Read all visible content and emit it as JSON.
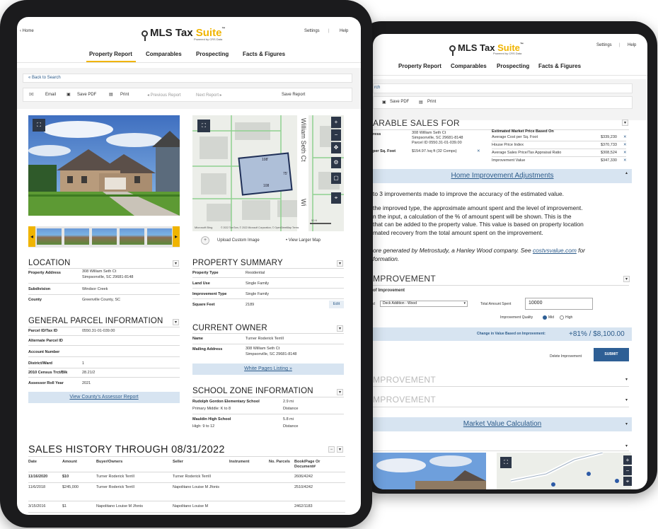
{
  "front": {
    "nav": {
      "home": "‹ Home",
      "settings": "Settings",
      "sep": "|",
      "help": "Help"
    },
    "logo": {
      "mls": "MLS Tax ",
      "suite": "Suite",
      "tm": "™",
      "powered": "Powered by CRS Data"
    },
    "tabs": [
      "Property Report",
      "Comparables",
      "Prospecting",
      "Facts & Figures"
    ],
    "back": "« Back to Search",
    "toolbar": {
      "email": "Email",
      "pdf": "Save PDF",
      "print": "Print",
      "prev": "◂ Previous Report",
      "next": "Next Report ▸",
      "save": "Save Report"
    },
    "map": {
      "lot": "108",
      "lot_a": "108'",
      "lot_b": "75'",
      "street1": "William Seth Ct",
      "street2": "Wi",
      "scale": "50 ft",
      "credit": "© 2022 TomTom, © 2022 Microsoft Corporation, © OpenStreetMap  Terms",
      "upload": "Upload Custom Image",
      "larger": "• View Larger Map",
      "brand": "Microsoft Bing"
    },
    "location": {
      "title": "LOCATION",
      "rows": [
        {
          "k": "Property Address",
          "v1": "308 William Seth Ct",
          "v2": "Simpsonville, SC 29681-8148"
        },
        {
          "k": "Subdivision",
          "v1": "Windsor Creek",
          "v2": ""
        },
        {
          "k": "County",
          "v1": "Greenville County, SC",
          "v2": ""
        }
      ]
    },
    "property_summary": {
      "title": "PROPERTY SUMMARY",
      "rows": [
        {
          "k": "Property Type",
          "v": "Residential"
        },
        {
          "k": "Land Use",
          "v": "Single Family"
        },
        {
          "k": "Improvement Type",
          "v": "Single Family"
        },
        {
          "k": "Square Feet",
          "v": "2189"
        }
      ],
      "edit": "Edit"
    },
    "parcel": {
      "title": "GENERAL PARCEL INFORMATION",
      "rows": [
        {
          "k": "Parcel ID/Tax ID",
          "v": "0550.31-01-039.00"
        },
        {
          "k": "Alternate Parcel ID",
          "v": ""
        },
        {
          "k": "Account Number",
          "v": ""
        },
        {
          "k": "District/Ward",
          "v": "1"
        },
        {
          "k": "2010 Census Trct/Blk",
          "v": "28.21/2"
        },
        {
          "k": "Assessor Roll Year",
          "v": "2021"
        }
      ],
      "assessor": "View County's Assessor Report"
    },
    "owner": {
      "title": "CURRENT OWNER",
      "rows": [
        {
          "k": "Name",
          "v1": "Turner Roderick Terrill",
          "v2": ""
        },
        {
          "k": "Mailing Address",
          "v1": "308 William Seth Ct",
          "v2": "Simpsonville, SC 29681-8148"
        }
      ],
      "white_pages": "White Pages Listing »"
    },
    "school": {
      "title": "SCHOOL ZONE INFORMATION",
      "rows": [
        {
          "k": "Rudolph Gordon Elementary School",
          "v": "2.9 mi",
          "bold": true
        },
        {
          "k": "Primary Middle: K to 8",
          "v": "Distance",
          "bold": false
        },
        {
          "k": "Mauldin High School",
          "v": "5.8 mi",
          "bold": true
        },
        {
          "k": "High: 9 to 12",
          "v": "Distance",
          "bold": false
        }
      ]
    },
    "sales": {
      "title": "SALES HISTORY THROUGH 08/31/2022",
      "headers": [
        "Date",
        "Amount",
        "Buyer/Owners",
        "Seller",
        "Instrument",
        "No. Parcels",
        "Book/Page Or Document#"
      ],
      "rows": [
        [
          "11/16/2020",
          "$10",
          "Turner Roderick Terrill",
          "Turner Roderick Terrill",
          "",
          "",
          "2606/4242"
        ],
        [
          "11/6/2018",
          "$245,000",
          "Turner Roderick Terrill",
          "Napolitano Louise M Jfonis",
          "",
          "",
          "2510/4242"
        ],
        [
          "3/15/2016",
          "$1",
          "Napolitano Louise M Jfonis",
          "Napolitano Louise M",
          "",
          "",
          "2462/1183"
        ]
      ]
    }
  },
  "back": {
    "nav": {
      "settings": "Settings",
      "sep": "|",
      "help": "Help"
    },
    "logo": {
      "mls": "MLS Tax ",
      "suite": "Suite",
      "tm": "™",
      "powered": "Powered by CRS Data"
    },
    "tabs": [
      "Property Report",
      "Comparables",
      "Prospecting",
      "Facts & Figures"
    ],
    "search_frag": "rch",
    "toolbar": {
      "pdf": "Save PDF",
      "print": "Print"
    },
    "comp_title": "ARABLE SALES FOR",
    "comp_left": [
      {
        "k": "ress",
        "v1": "308 William Seth Ct",
        "v2": "Simpsonville, SC 29681-8148"
      },
      {
        "k": "",
        "v1": "Parcel ID 0550.31-01-039.00",
        "v2": ""
      },
      {
        "k": "per Sq. Foot",
        "v1": "$154.97 /sq ft (32 Comps)",
        "v2": ""
      }
    ],
    "comp_right_title": "Estimated Market Price Based On",
    "comp_right": [
      {
        "k": "Average Cost per Sq. Foot",
        "v": "$339,230"
      },
      {
        "k": "House Price Index",
        "v": "$370,733"
      },
      {
        "k": "Average Sales Price/Tax Appraisal Ratio",
        "v": "$308,524"
      },
      {
        "k": "Improvement Value",
        "v": "$347,330"
      }
    ],
    "hia": "Home Improvement Adjustments",
    "paragraph": [
      "to 3 improvements made to improve the accuracy of the estimated value.",
      "the improved type, the approximate amount spent and the level of improvement.",
      "n the input, a calculation of the % of amount spent will be shown. This is the",
      "that can be added to the property value. This value is based on property location",
      "mated recovery from the total amount spent on the improvement."
    ],
    "para_src_pre": "ore generated by Metrostudy, a Hanley Wood company. See ",
    "para_src_link": "costvsvalue.com",
    "para_src_post": " for",
    "para_last": "formation.",
    "improvement_title": "MPROVEMENT",
    "type_label": "of Improvement",
    "select_value": "Deck Addition - Wood",
    "amount_label": "Total Amount Spent",
    "amount_value": "10000",
    "quality_label": "Improvement Quality",
    "quality_mid": "Mid",
    "quality_high": "High",
    "change_label": "Change in Value Based on Improvement:",
    "change_value": "+81% / $8,100.00",
    "delete": "Delete Improvement",
    "submit": "SUBMIT",
    "improvement2": "MPROVEMENT",
    "improvement3": "MPROVEMENT",
    "mvc": "Market Value Calculation"
  }
}
